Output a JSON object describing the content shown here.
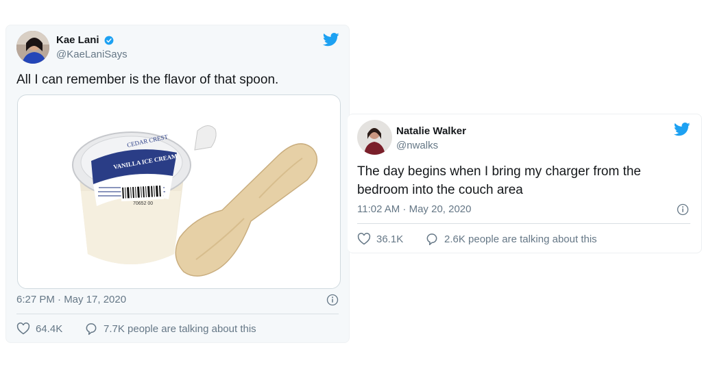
{
  "tweet1": {
    "name": "Kae Lani",
    "handle": "@KaeLaniSays",
    "text": "All I can remember is the flavor of that spoon.",
    "timestamp": "6:27 PM · May 17, 2020",
    "likes": "64.4K",
    "talking": "7.7K people are talking about this",
    "media": {
      "brand": "CEDAR CREST",
      "product": "VANILLA ICE CREAM",
      "barcode_digits": "70652 00"
    }
  },
  "tweet2": {
    "name": "Natalie Walker",
    "handle": "@nwalks",
    "text": "The day begins when I bring my charger from the bedroom into the couch area",
    "timestamp": "11:02 AM · May 20, 2020",
    "likes": "36.1K",
    "talking": "2.6K people are talking about this"
  },
  "colors": {
    "twitter_blue": "#1da1f2",
    "muted": "#657786"
  },
  "icons": [
    "twitter-bird-icon",
    "verified-badge-icon",
    "info-icon",
    "heart-icon",
    "comment-icon"
  ]
}
